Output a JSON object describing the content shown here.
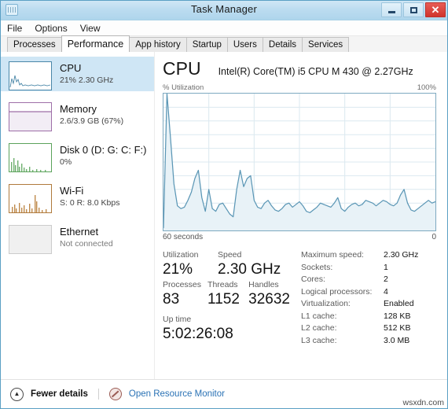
{
  "window": {
    "title": "Task Manager",
    "icon": "task-manager-icon",
    "buttons": {
      "minimize": "–",
      "maximize": "❐",
      "close": "✕"
    }
  },
  "menu": {
    "items": [
      "File",
      "Options",
      "View"
    ]
  },
  "tabs": [
    {
      "label": "Processes",
      "active": false
    },
    {
      "label": "Performance",
      "active": true
    },
    {
      "label": "App history",
      "active": false
    },
    {
      "label": "Startup",
      "active": false
    },
    {
      "label": "Users",
      "active": false
    },
    {
      "label": "Details",
      "active": false
    },
    {
      "label": "Services",
      "active": false
    }
  ],
  "sidebar": {
    "items": [
      {
        "name": "CPU",
        "title": "CPU",
        "sub": "21%  2.30 GHz",
        "color": "#4a87a8",
        "selected": true,
        "type": "line"
      },
      {
        "name": "Memory",
        "title": "Memory",
        "sub": "2.6/3.9 GB (67%)",
        "color": "#9e6fa8",
        "selected": false,
        "type": "fill"
      },
      {
        "name": "Disk 0",
        "title": "Disk 0 (D: G: C: F:)",
        "sub": "0%",
        "color": "#5ba35b",
        "selected": false,
        "type": "line"
      },
      {
        "name": "Wi-Fi",
        "title": "Wi-Fi",
        "sub": "S: 0 R: 8.0 Kbps",
        "color": "#b07a3c",
        "selected": false,
        "type": "line"
      },
      {
        "name": "Ethernet",
        "title": "Ethernet",
        "sub": "Not connected",
        "color": "#cccccc",
        "selected": false,
        "type": "empty"
      }
    ]
  },
  "cpu": {
    "heading": "CPU",
    "model": "Intel(R) Core(TM) i5 CPU M 430 @ 2.27GHz",
    "axis_label": "% Utilization",
    "axis_max": "100%",
    "time_left": "60 seconds",
    "time_right": "0",
    "accent": "#5a96b5"
  },
  "stats": {
    "utilization": {
      "label": "Utilization",
      "value": "21%"
    },
    "speed": {
      "label": "Speed",
      "value": "2.30 GHz"
    },
    "processes": {
      "label": "Processes",
      "value": "83"
    },
    "threads": {
      "label": "Threads",
      "value": "1152"
    },
    "handles": {
      "label": "Handles",
      "value": "32632"
    },
    "uptime": {
      "label": "Up time",
      "value": "5:02:26:08"
    }
  },
  "specs": [
    {
      "key": "Maximum speed:",
      "value": "2.30 GHz"
    },
    {
      "key": "Sockets:",
      "value": "1"
    },
    {
      "key": "Cores:",
      "value": "2"
    },
    {
      "key": "Logical processors:",
      "value": "4"
    },
    {
      "key": "Virtualization:",
      "value": "Enabled"
    },
    {
      "key": "L1 cache:",
      "value": "128 KB"
    },
    {
      "key": "L2 cache:",
      "value": "512 KB"
    },
    {
      "key": "L3 cache:",
      "value": "3.0 MB"
    }
  ],
  "footer": {
    "fewer_details": "Fewer details",
    "resource_monitor": "Open Resource Monitor"
  },
  "watermark": "wsxdn.com",
  "chart_data": {
    "type": "area",
    "title": "CPU % Utilization",
    "xlabel": "",
    "ylabel": "% Utilization",
    "ylim": [
      0,
      100
    ],
    "xlim": [
      60,
      0
    ],
    "x_tick_labels": [
      "60 seconds",
      "0"
    ],
    "y_tick_labels": [
      "100%"
    ],
    "grid": true,
    "grid_cols": 6,
    "grid_rows": 10,
    "legend": "none",
    "series": [
      {
        "name": "CPU utilization",
        "color": "#5a96b5",
        "fill": "#e8f2f7",
        "values": [
          2,
          100,
          68,
          34,
          18,
          16,
          17,
          22,
          28,
          38,
          44,
          24,
          14,
          30,
          16,
          14,
          19,
          20,
          16,
          12,
          10,
          30,
          44,
          32,
          38,
          40,
          22,
          17,
          16,
          20,
          22,
          18,
          15,
          14,
          16,
          19,
          20,
          17,
          19,
          21,
          18,
          14,
          13,
          15,
          17,
          20,
          19,
          18,
          17,
          20,
          24,
          16,
          14,
          17,
          19,
          20,
          18,
          19,
          22,
          21,
          20,
          18,
          20,
          22,
          21,
          19,
          18,
          20,
          26,
          30,
          20,
          15,
          14,
          16,
          18,
          20,
          22,
          20,
          21
        ]
      }
    ]
  }
}
